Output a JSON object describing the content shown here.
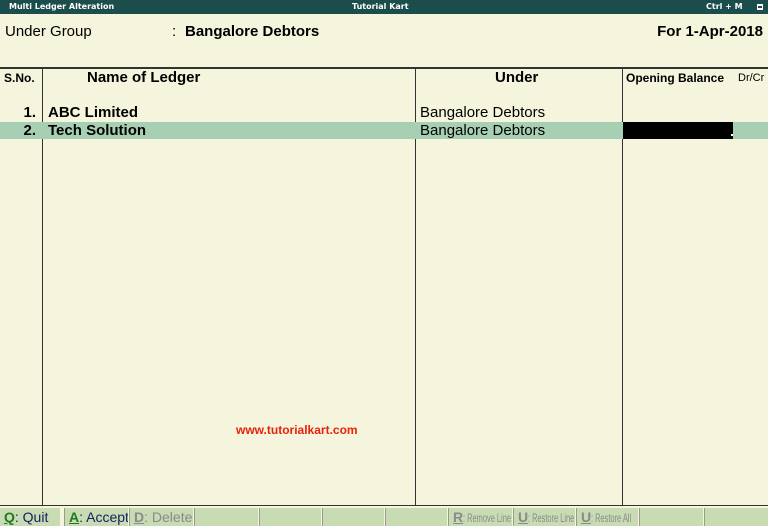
{
  "titlebar": {
    "left": "Multi Ledger  Alteration",
    "center": "Tutorial Kart",
    "right": "Ctrl + M"
  },
  "header": {
    "under_group_label": "Under Group",
    "colon": ":",
    "under_group_value": "Bangalore Debtors",
    "period": "For 1-Apr-2018"
  },
  "columns": {
    "sno": "S.No.",
    "name": "Name of Ledger",
    "under": "Under",
    "opening": "Opening Balance",
    "drcr": "Dr/Cr"
  },
  "rows": [
    {
      "sno": "1.",
      "name": "ABC Limited",
      "under": "Bangalore Debtors",
      "opening": ""
    },
    {
      "sno": "2.",
      "name": "Tech Solution",
      "under": "Bangalore Debtors",
      "opening": ""
    }
  ],
  "watermark": "www.tutorialkart.com",
  "buttons": {
    "quit": {
      "key": "Q",
      "label": ": Quit"
    },
    "accept": {
      "key": "A",
      "label": ": Accept"
    },
    "delete": {
      "key": "D",
      "label": ": Delete"
    },
    "remove_line": {
      "key": "R",
      "label": ": Remove Line"
    },
    "restore_line": {
      "key": "U",
      "label": ": Restore Line"
    },
    "restore_all": {
      "key": "U",
      "label": ": Restore All"
    }
  },
  "colors": {
    "titlebar": "#1c4d4d",
    "background": "#f5f4dc",
    "selected_row": "#a7cfb3",
    "button": "#c8dbb2",
    "watermark": "#e8220b"
  }
}
